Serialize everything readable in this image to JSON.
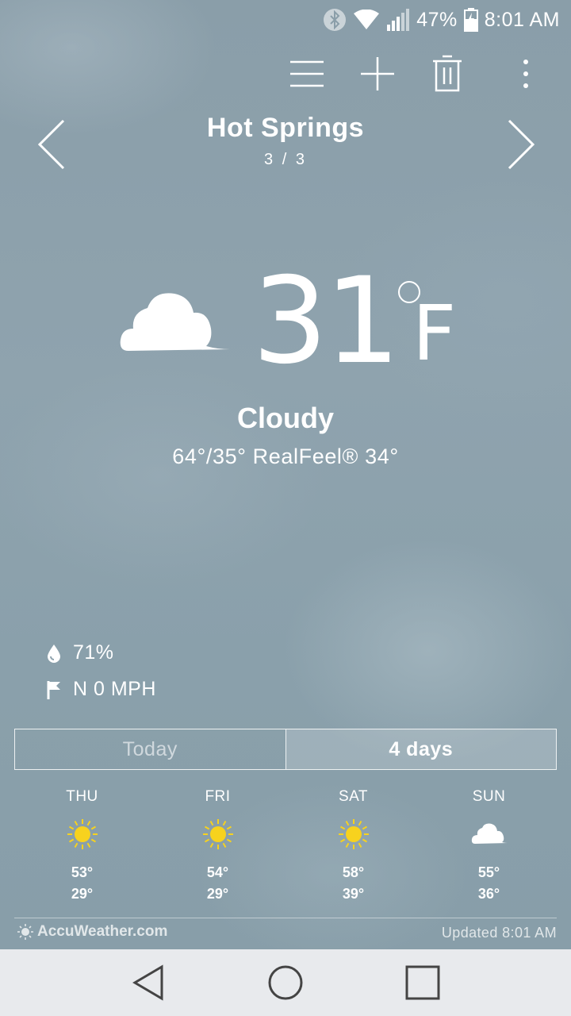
{
  "status_bar": {
    "battery": "47%",
    "time": "8:01 AM",
    "icons": [
      "bluetooth-icon",
      "wifi-icon",
      "signal-icon",
      "battery-charging-icon"
    ]
  },
  "toolbar": {
    "icons": [
      "menu-icon",
      "add-icon",
      "trash-icon",
      "overflow-menu-icon"
    ]
  },
  "location": {
    "city": "Hot Springs",
    "page_indicator": "3 / 3",
    "prev_icon": "chevron-left-icon",
    "next_icon": "chevron-right-icon"
  },
  "current": {
    "icon": "cloudy-icon",
    "temperature": "31",
    "unit": "F",
    "condition": "Cloudy",
    "hilo_realfeel": "64°/35° RealFeel® 34°"
  },
  "details": {
    "humidity": "71%",
    "humidity_icon": "humidity-drop-icon",
    "wind": "N 0 MPH",
    "wind_icon": "wind-flag-icon"
  },
  "tabs": {
    "today": "Today",
    "four_days": "4 days",
    "selected": "4 days"
  },
  "forecast": [
    {
      "day": "THU",
      "icon": "sunny-icon",
      "high": "53°",
      "low": "29°"
    },
    {
      "day": "FRI",
      "icon": "sunny-icon",
      "high": "54°",
      "low": "29°"
    },
    {
      "day": "SAT",
      "icon": "sunny-icon",
      "high": "58°",
      "low": "39°"
    },
    {
      "day": "SUN",
      "icon": "cloudy-icon",
      "high": "55°",
      "low": "36°"
    }
  ],
  "footer": {
    "brand": "AccuWeather.com",
    "updated": "Updated 8:01 AM"
  },
  "colors": {
    "sun": "#f7d21e",
    "background": "#8ca1ac",
    "navbar": "#e8eaed"
  }
}
